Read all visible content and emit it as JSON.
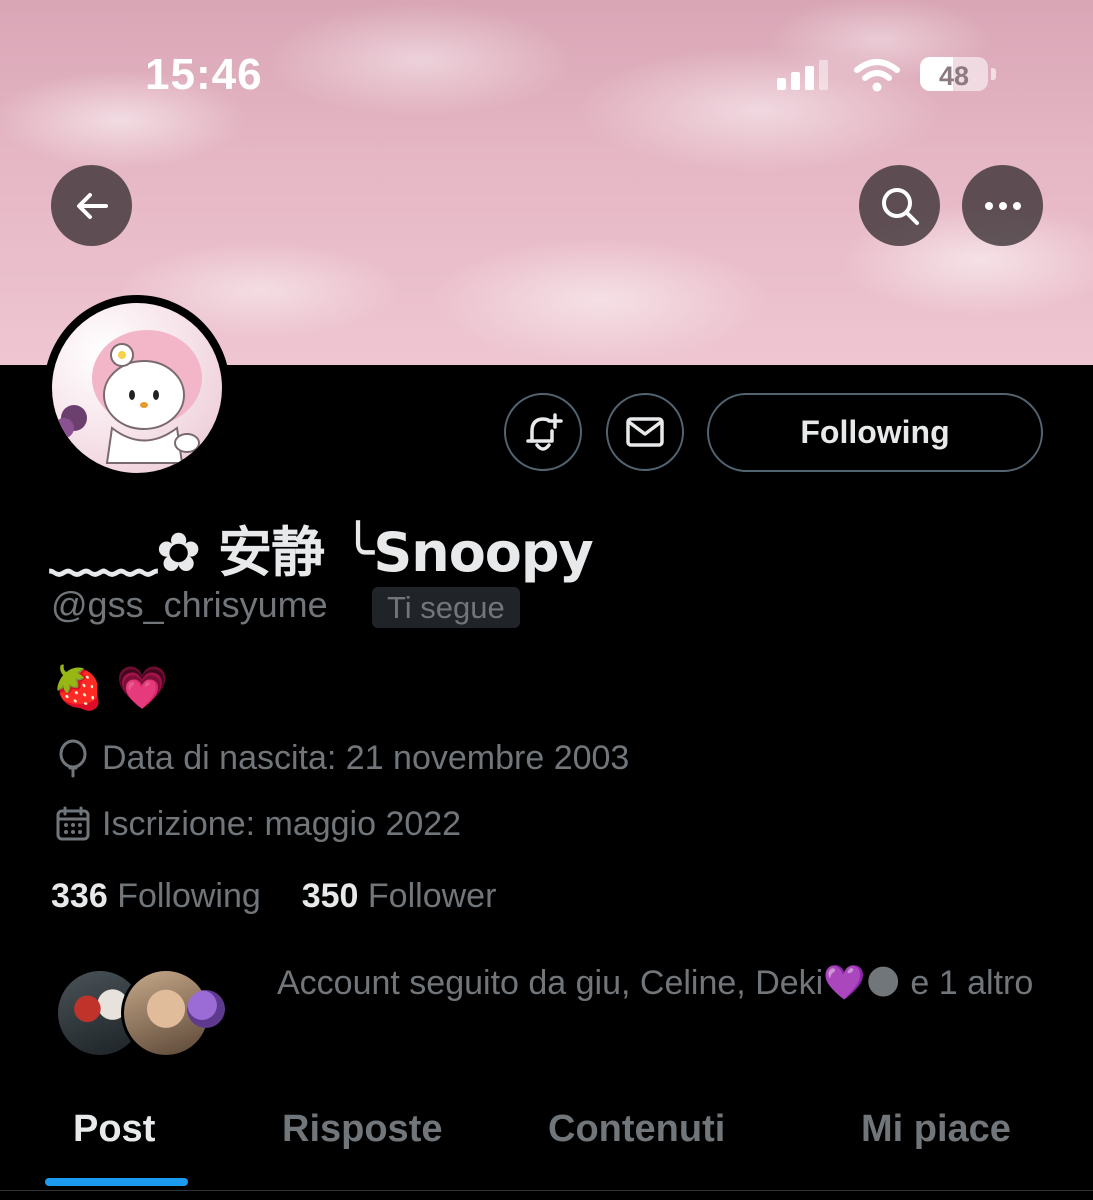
{
  "status_bar": {
    "time": "15:46",
    "battery_level": "48",
    "signal_bars": 3
  },
  "header": {
    "back_icon": "arrow-left-icon",
    "search_icon": "search-icon",
    "more_icon": "more-horizontal-icon"
  },
  "profile": {
    "display_name": "﹏﹏✿ 安静 ╰Snoopy",
    "handle": "@gss_chrisyume",
    "follows_you_badge": "Ti segue",
    "bio": "🍓 💗",
    "birth_date": "Data di nascita: 21 novembre 2003",
    "joined": "Iscrizione: maggio 2022",
    "following_count": "336",
    "following_label": "Following",
    "followers_count": "350",
    "followers_label": "Follower",
    "mutuals_text": "Account seguito da giu, Celine, Deki💜🌑 e 1 altro"
  },
  "actions": {
    "notify_icon": "bell-plus-icon",
    "message_icon": "mail-icon",
    "following_button": "Following"
  },
  "tabs": [
    {
      "label": "Post",
      "active": true
    },
    {
      "label": "Risposte",
      "active": false
    },
    {
      "label": "Contenuti",
      "active": false
    },
    {
      "label": "Mi piace",
      "active": false
    }
  ],
  "colors": {
    "accent": "#1d9bf0",
    "background": "#000000",
    "muted_text": "#71767b",
    "banner_pink": "#e6b7c5"
  }
}
